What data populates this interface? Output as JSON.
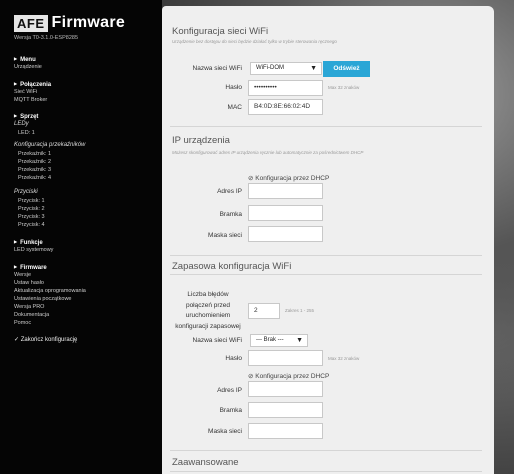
{
  "logo": {
    "box": "AFE",
    "text": "Firmware"
  },
  "version": "Wersja T0-3.1.0-ESP8285",
  "sidebar": {
    "sections": [
      {
        "title": "Menu",
        "items": [
          "Urządzenie"
        ]
      },
      {
        "title": "Połączenia",
        "items": [
          "Sieć WiFi",
          "MQTT Broker"
        ]
      },
      {
        "title": "Sprzęt"
      },
      {
        "title": "Funkcje",
        "items": [
          "LED systemowy"
        ]
      },
      {
        "title": "Firmware",
        "items": [
          "Wersje",
          "Ustaw hasło",
          "Aktualizacja oprogramowania",
          "Ustawienia początkowe",
          "Wersja PRO",
          "Dokumentacja",
          "Pomoc"
        ]
      }
    ],
    "leds_label": "LEDy",
    "led_items": [
      "LED: 1"
    ],
    "relays_label": "Konfiguracja przekaźników",
    "relay_items": [
      "Przekaźnik: 1",
      "Przekaźnik: 2",
      "Przekaźnik: 3",
      "Przekaźnik: 4"
    ],
    "buttons_label": "Przyciski",
    "button_items": [
      "Przycisk: 1",
      "Przycisk: 2",
      "Przycisk: 3",
      "Przycisk: 4"
    ],
    "finish": "✓ Zakończ konfigurację"
  },
  "wifi": {
    "title": "Konfiguracja sieci WiFi",
    "desc": "Urządzenie bez dostępu do sieci będzie działać tylko w trybie sterowania ręcznego",
    "ssid_label": "Nazwa sieci WiFi",
    "ssid_value": "WiFi-DOM",
    "refresh": "Odśwież",
    "pass_label": "Hasło",
    "pass_value": "••••••••••",
    "pass_hint": "Max 32 znaków",
    "mac_label": "MAC",
    "mac_value": "B4:0D:8E:66:02:4D"
  },
  "ip": {
    "title": "IP urządzenia",
    "desc": "Możesz skonfigurować adres IP urządzenia ręcznie lub automatycznie za pośrednictwem DHCP",
    "dhcp": "Konfiguracja przez DHCP",
    "addr_label": "Adres IP",
    "gw_label": "Bramka",
    "mask_label": "Maska sieci"
  },
  "backup": {
    "title": "Zapasowa konfiguracja WiFi",
    "retries_label_lines": [
      "Liczba błędów",
      "połączeń przed",
      "uruchomieniem",
      "konfiguracji zapasowej"
    ],
    "retries_value": "2",
    "retries_hint": "Zakres 1 - 255",
    "ssid_label": "Nazwa sieci WiFi",
    "ssid_value": "--- Brak ---",
    "pass_label": "Hasło",
    "pass_hint": "Max 32 znaków",
    "dhcp": "Konfiguracja przez DHCP",
    "addr_label": "Adres IP",
    "gw_label": "Bramka",
    "mask_label": "Maska sieci"
  },
  "advanced": {
    "title": "Zaawansowane"
  }
}
